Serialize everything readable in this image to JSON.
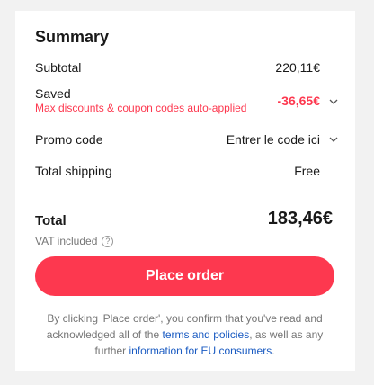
{
  "summary": {
    "title": "Summary",
    "subtotal_label": "Subtotal",
    "subtotal_value": "220,11€",
    "saved_label": "Saved",
    "saved_note": "Max discounts & coupon codes auto-applied",
    "saved_value": "-36,65€",
    "promo_label": "Promo code",
    "promo_value": "Entrer le code ici",
    "shipping_label": "Total shipping",
    "shipping_value": "Free",
    "total_label": "Total",
    "total_value": "183,46€",
    "vat_label": "VAT included",
    "help_icon_glyph": "?"
  },
  "actions": {
    "place_order_label": "Place order"
  },
  "disclaimer": {
    "prefix": "By clicking 'Place order', you confirm that you've read and acknowledged all of the ",
    "terms_link": "terms and policies",
    "middle": ", as well as any further ",
    "eu_link": "information for EU consumers",
    "suffix": "."
  },
  "colors": {
    "accent": "#fd384f",
    "link": "#1a5bc2",
    "background": "#f2f2f2",
    "card": "#ffffff"
  },
  "icons": [
    "chevron-down-icon",
    "help-circle-icon"
  ]
}
